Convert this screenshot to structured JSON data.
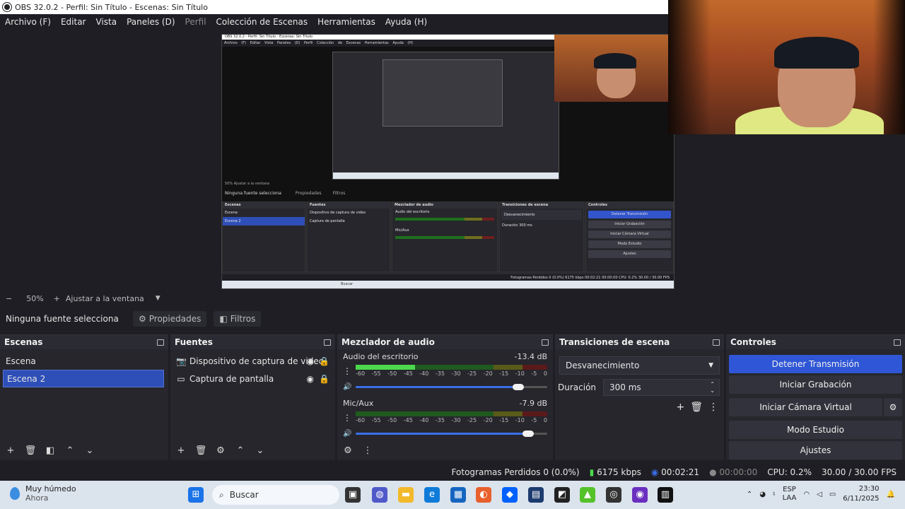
{
  "titlebar": {
    "text": "OBS 32.0.2 - Perfil: Sin Título - Escenas: Sin Título"
  },
  "menu": {
    "archivo": "Archivo (F)",
    "editar": "Editar",
    "vista": "Vista",
    "paneles": "Paneles (D)",
    "perfil": "Perfil",
    "coleccion": "Colección de Escenas",
    "herramientas": "Herramientas",
    "ayuda": "Ayuda (H)"
  },
  "zoom": {
    "minus": "−",
    "value": "50%",
    "plus": "+",
    "fit": "Ajustar a la ventana",
    "caret": "▼"
  },
  "sourcebar": {
    "none": "Ninguna fuente selecciona",
    "props": "Propiedades",
    "filters": "Filtros"
  },
  "scenes": {
    "title": "Escenas",
    "items": [
      {
        "label": "Escena"
      },
      {
        "label": "Escena 2"
      }
    ]
  },
  "sources": {
    "title": "Fuentes",
    "items": [
      {
        "label": "Dispositivo de captura de video",
        "icon": "camera-icon"
      },
      {
        "label": "Captura de pantalla",
        "icon": "monitor-icon"
      }
    ]
  },
  "mixer": {
    "title": "Mezclador de audio",
    "ticks": [
      "-60",
      "-55",
      "-50",
      "-45",
      "-40",
      "-35",
      "-30",
      "-25",
      "-20",
      "-15",
      "-10",
      "-5",
      "0"
    ],
    "channels": [
      {
        "name": "Audio del escritorio",
        "db": "-13.4 dB",
        "level": 0.31,
        "volume": 0.85
      },
      {
        "name": "Mic/Aux",
        "db": "-7.9 dB",
        "level": 0.0,
        "volume": 0.9
      }
    ]
  },
  "transitions": {
    "title": "Transiciones de escena",
    "selected": "Desvanecimiento",
    "duration_label": "Duración",
    "duration_value": "300 ms"
  },
  "controls": {
    "title": "Controles",
    "stop_stream": "Detener Transmisión",
    "start_record": "Iniciar Grabación",
    "virtual_cam": "Iniciar Cámara Virtual",
    "studio_mode": "Modo Estudio",
    "settings": "Ajustes"
  },
  "status": {
    "dropped": "Fotogramas Perdidos 0 (0.0%)",
    "bitrate": "6175 kbps",
    "stream_time": "00:02:21",
    "rec_time": "00:00:00",
    "cpu": "CPU: 0.2%",
    "fps": "30.00 / 30.00 FPS"
  },
  "taskbar": {
    "weather_title": "Muy húmedo",
    "weather_sub": "Ahora",
    "search": "Buscar",
    "lang1": "ESP",
    "lang2": "LAA",
    "time": "23:30",
    "date": "6/11/2025"
  },
  "nested": {
    "title": "OBS 32.0.2 - Perfil: Sin Título - Escenas: Sin Título",
    "menu": "Archivo (F) Editar Vista Paneles (D) Perfil Colección de Escenas Herramientas Ayuda (H)",
    "zoom": "50%   Ajustar a la ventana",
    "nosrc": "Ninguna fuente selecciona",
    "props": "Propiedades",
    "filters": "Filtros",
    "scenes": "Escenas",
    "scene1": "Escena",
    "scene2": "Escena 2",
    "sources": "Fuentes",
    "src1": "Dispositivo de captura de video",
    "src2": "Captura de pantalla",
    "mixer": "Mezclador de audio",
    "ch1": "Audio del escritorio",
    "ch2": "Mic/Aux",
    "transitions": "Transiciones de escena",
    "tr_sel": "Desvanecimiento",
    "dur": "Duración",
    "dur_val": "300 ms",
    "controls": "Controles",
    "b1": "Detener Transmisión",
    "b2": "Iniciar Grabación",
    "b3": "Iniciar Cámara Virtual",
    "b4": "Modo Estudio",
    "b5": "Ajustes",
    "status": "Fotogramas Perdidos 0 (0.0%)   6175 kbps   00:02:21   00:00:00   CPU: 0.2%   30.00 / 30.00 FPS",
    "search": "Buscar"
  }
}
